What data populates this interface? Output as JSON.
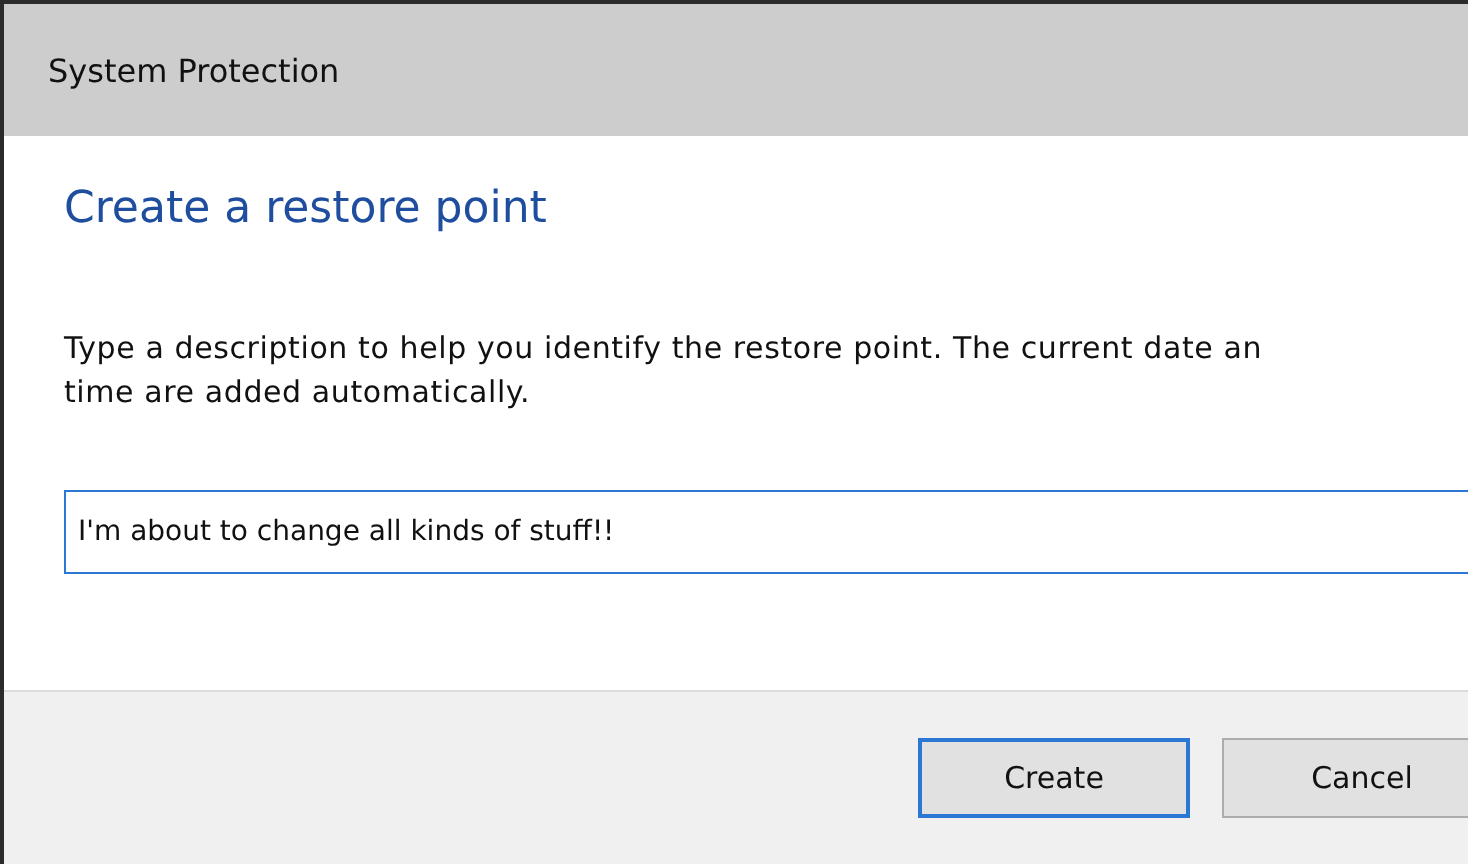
{
  "window": {
    "title": "System Protection"
  },
  "heading": "Create a restore point",
  "description_lines": [
    "Type a description to help you identify the restore point. The current date an",
    "time are added automatically."
  ],
  "field": {
    "value": "I'm about to change all kinds of stuff!!",
    "focused": true
  },
  "buttons": [
    {
      "label": "Create",
      "default": true
    },
    {
      "label": "Cancel",
      "default": false
    }
  ]
}
